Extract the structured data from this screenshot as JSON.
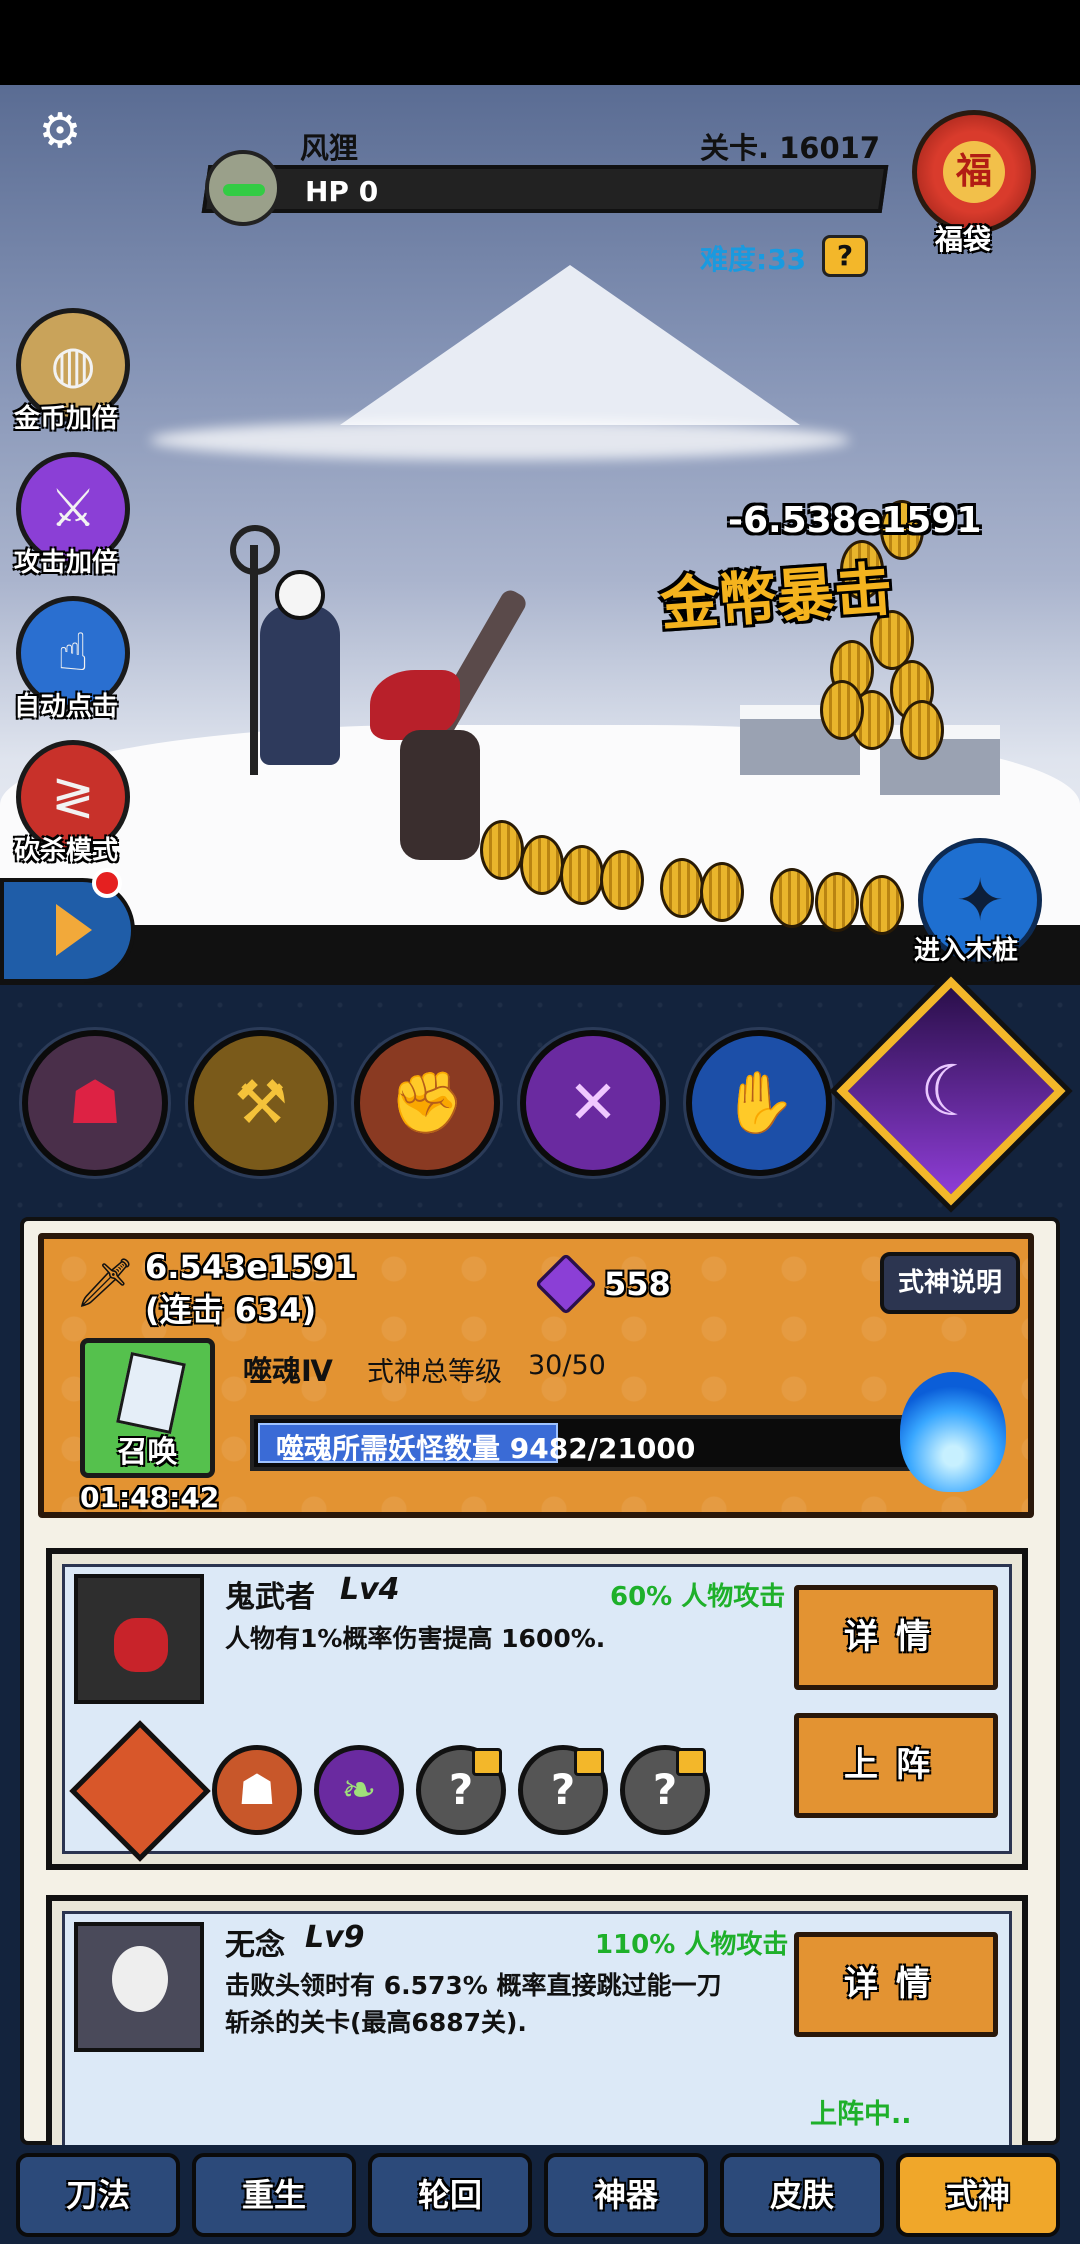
{
  "boss": {
    "name": "风狸",
    "hp": "HP 0",
    "stage": "关卡. 16017",
    "difficulty": "难度:33",
    "difficulty_help": "?"
  },
  "lucky_bag": {
    "glyph": "福",
    "label": "福袋"
  },
  "side_buttons": [
    {
      "label": "金币加倍",
      "icon": "gold-coin-icon",
      "color": "#c9a35a"
    },
    {
      "label": "攻击加倍",
      "icon": "swords-icon",
      "color": "#8b3fd6"
    },
    {
      "label": "自动点击",
      "icon": "auto-click-icon",
      "color": "#2a6fd0"
    },
    {
      "label": "砍杀模式",
      "icon": "slash-icon",
      "color": "#c8312a"
    }
  ],
  "battle": {
    "damage": "-6.538e1591",
    "crit": "金幣暴击"
  },
  "stake_button": {
    "label": "进入木桩"
  },
  "skills": [
    {
      "icon": "beast-head-icon",
      "bg": "#4a2f4a"
    },
    {
      "icon": "golden-hammer-icon",
      "bg": "#7a5a1a"
    },
    {
      "icon": "fist-icon",
      "bg": "#8a3a22"
    },
    {
      "icon": "purple-slash-icon",
      "bg": "#6a2aa0"
    },
    {
      "icon": "bandaged-arm-icon",
      "bg": "#1c4fa8"
    },
    {
      "icon": "purple-claw-icon",
      "bg": "#5a1f9a"
    }
  ],
  "stats": {
    "attack": "6.543e1591",
    "combo": "(连击 634)",
    "gems": "558",
    "explain_button": "式神说明"
  },
  "summon": {
    "label": "召唤",
    "timer": "01:48:42",
    "devour_level": "噬魂Ⅳ",
    "total_level_label": "式神总等级",
    "total_level_value": "30/50",
    "progress_text": "噬魂所需妖怪数量 9482/21000",
    "progress": 0.4515
  },
  "shikigami": [
    {
      "name": "鬼武者",
      "lv": "Lv4",
      "bonus": "60% 人物攻击",
      "desc_lines": [
        "人物有1%概率伤害提高 1600%."
      ],
      "detail_button": "详情",
      "deploy_button": "上阵"
    },
    {
      "name": "无念",
      "lv": "Lv9",
      "bonus": "110% 人物攻击",
      "desc_lines": [
        "击败头领时有 6.573% 概率直接跳过能一刀",
        "斩杀的关卡(最高6887关)."
      ],
      "detail_button": "详情",
      "status": "上阵中.."
    }
  ],
  "slots": {
    "locked_glyph": "?"
  },
  "nav": [
    "刀法",
    "重生",
    "轮回",
    "神器",
    "皮肤",
    "式神"
  ]
}
